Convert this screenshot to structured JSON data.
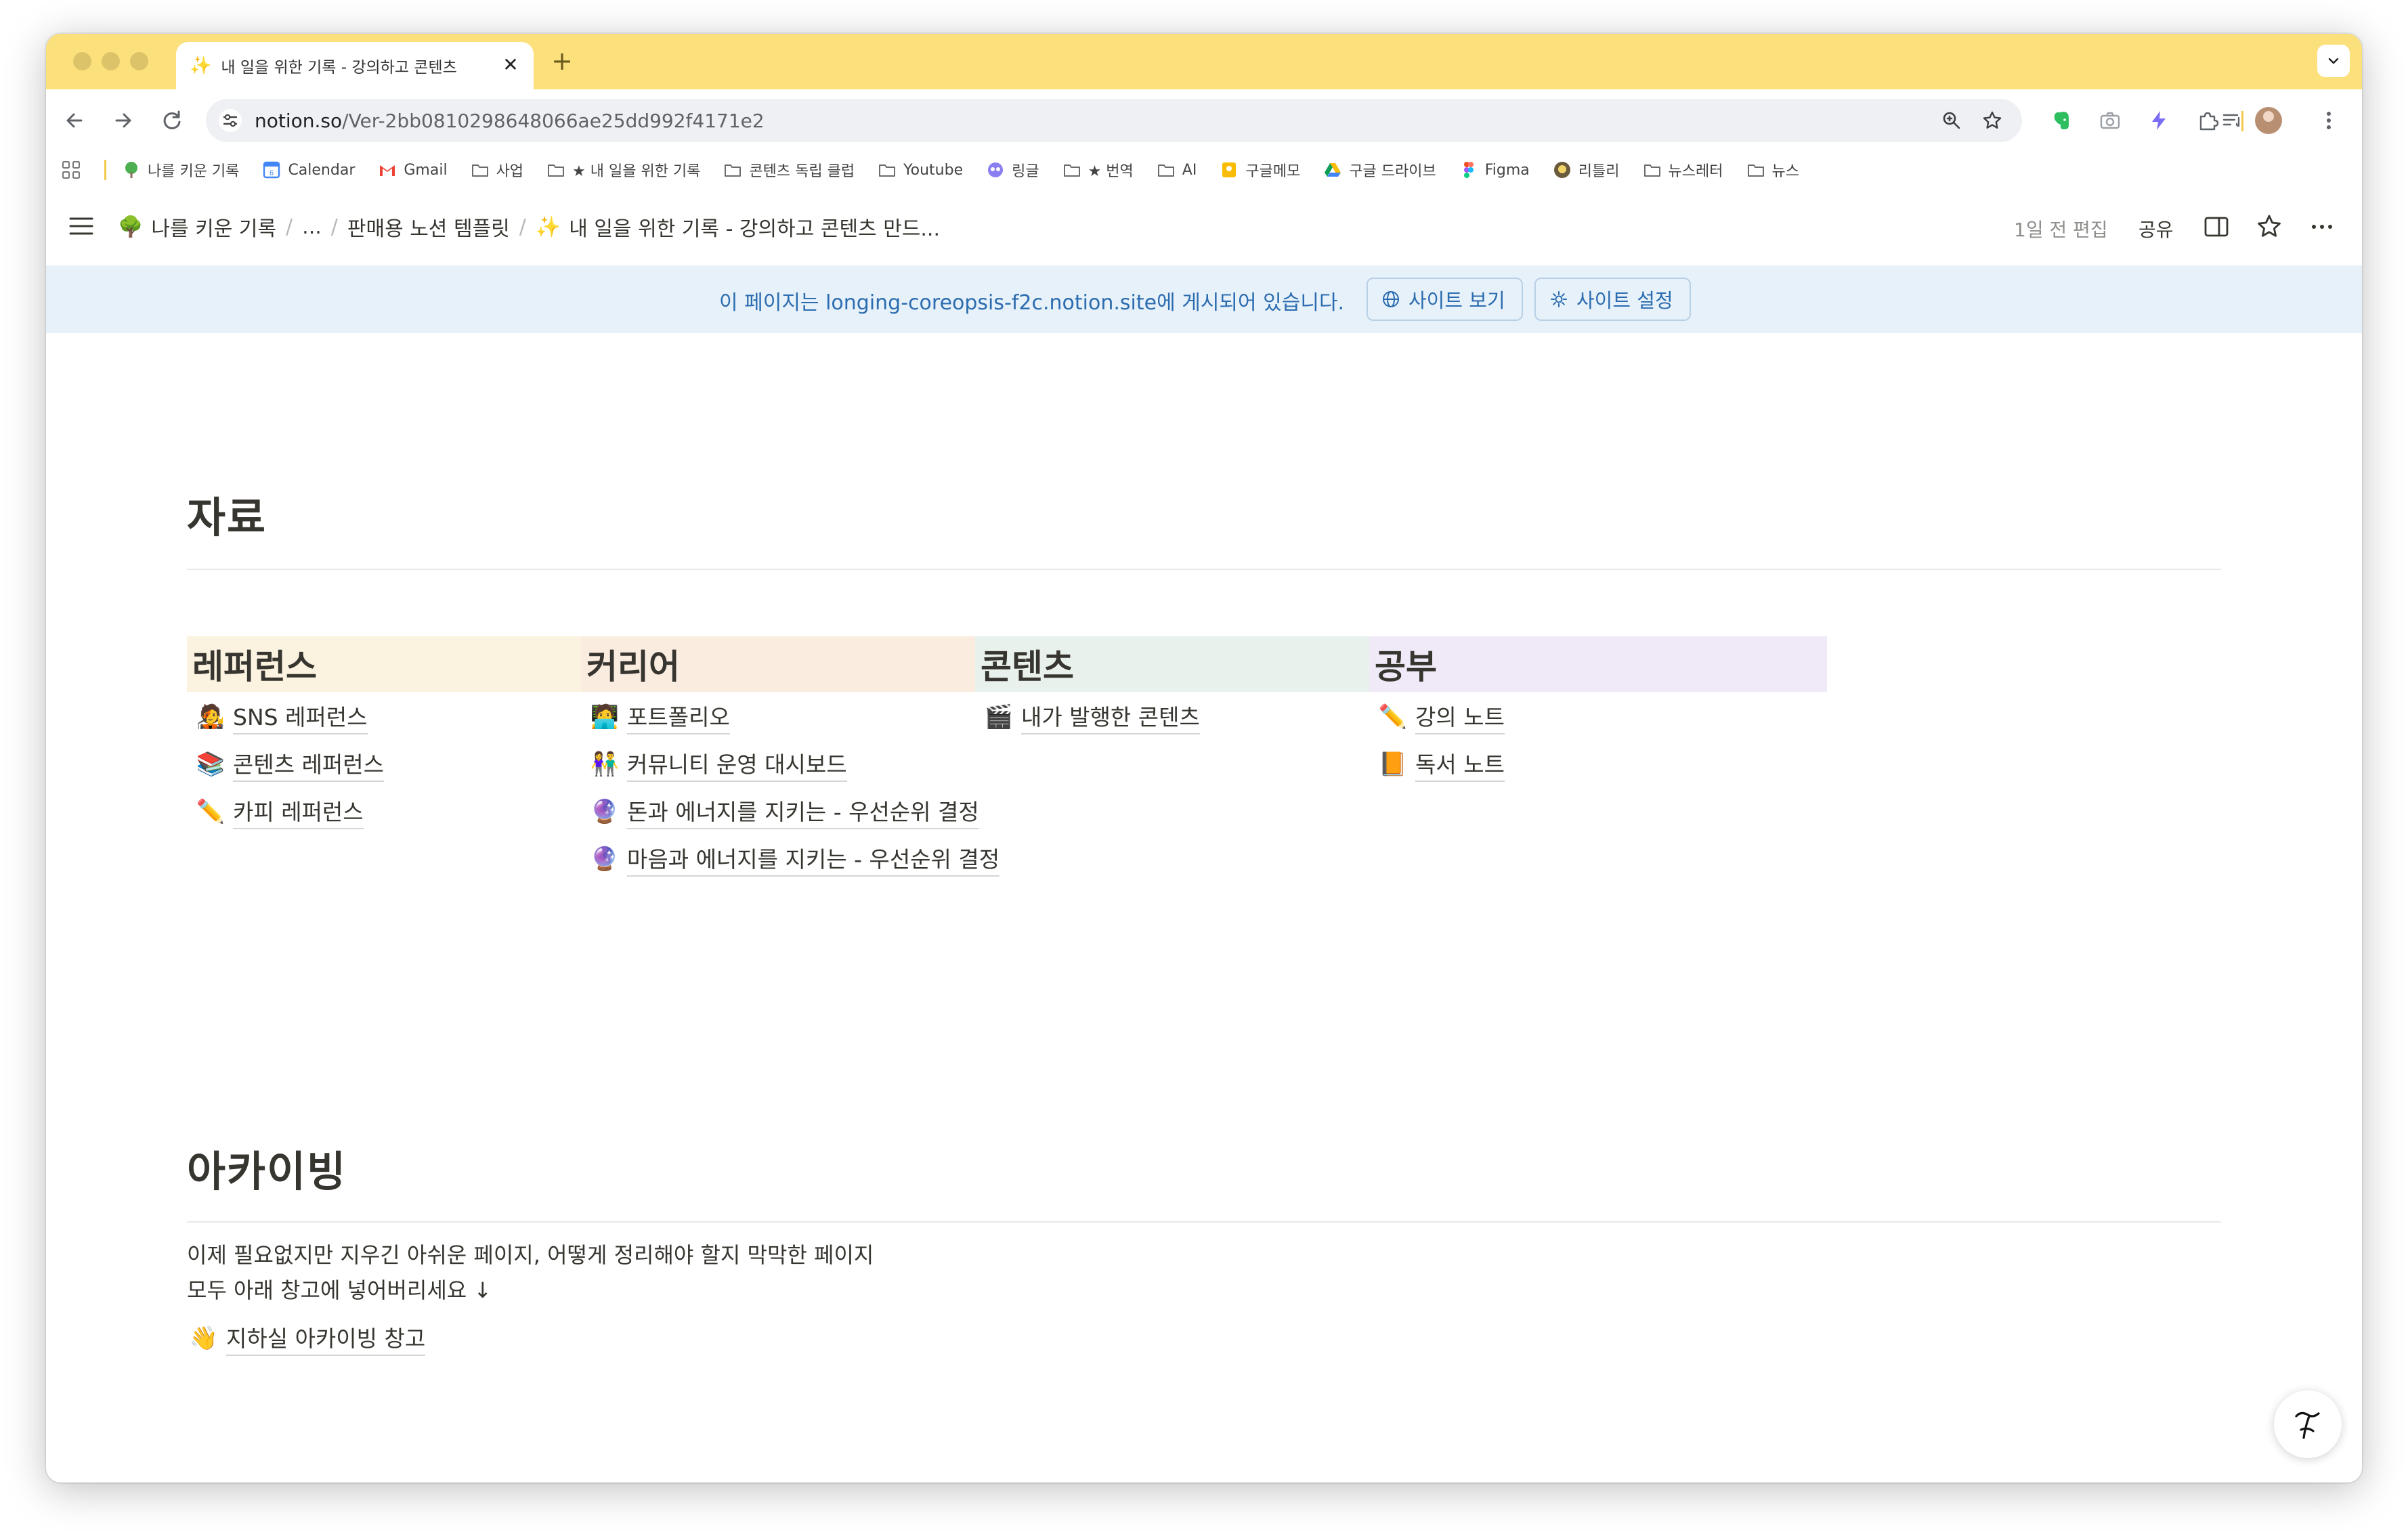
{
  "browser": {
    "tab": {
      "icon": "sparkles-icon",
      "title": "내 일을 위한 기록 - 강의하고 콘텐츠",
      "close": "✕"
    },
    "new_tab": "+",
    "url": {
      "domain": "notion.so",
      "path": "/Ver-2bb0810298648066ae25dd992f4171e2"
    },
    "accent": "#fce07c",
    "bookmarks": [
      {
        "icon": "tree-icon",
        "label": "나를 키운 기록"
      },
      {
        "icon": "calendar-icon",
        "label": "Calendar"
      },
      {
        "icon": "gmail-icon",
        "label": "Gmail"
      },
      {
        "icon": "folder-icon",
        "label": "사업"
      },
      {
        "icon": "folder-icon",
        "label": "★ 내 일을 위한 기록"
      },
      {
        "icon": "folder-icon",
        "label": "콘텐츠 독립 클럽"
      },
      {
        "icon": "folder-icon",
        "label": "Youtube"
      },
      {
        "icon": "link-icon",
        "label": "링글"
      },
      {
        "icon": "folder-icon",
        "label": "★ 번역"
      },
      {
        "icon": "folder-icon",
        "label": "AI"
      },
      {
        "icon": "memo-icon",
        "label": "구글메모"
      },
      {
        "icon": "drive-icon",
        "label": "구글 드라이브"
      },
      {
        "icon": "figma-icon",
        "label": "Figma"
      },
      {
        "icon": "lily-icon",
        "label": "리틀리"
      },
      {
        "icon": "folder-icon",
        "label": "뉴스레터"
      },
      {
        "icon": "folder-icon",
        "label": "뉴스"
      }
    ]
  },
  "notion": {
    "breadcrumbs": [
      {
        "icon": "🌳",
        "label": "나를 키운 기록"
      },
      {
        "icon": "",
        "label": "..."
      },
      {
        "icon": "",
        "label": "판매용 노션 템플릿"
      },
      {
        "icon": "✨",
        "label": "내 일을 위한 기록 - 강의하고 콘텐츠 만드..."
      }
    ],
    "edited": "1일 전 편집",
    "share": "공유",
    "banner": {
      "prefix": "이 페이지는 ",
      "site": "longing-coreopsis-f2c.notion.site",
      "suffix": "에 게시되어 있습니다.",
      "view_site": "사이트 보기",
      "site_settings": "사이트 설정"
    }
  },
  "page": {
    "section1": {
      "title": "자료",
      "columns": [
        {
          "title": "레퍼런스",
          "color": "#fbf3e0",
          "items": [
            {
              "emoji": "🧑‍🎤",
              "label": "SNS 레퍼런스"
            },
            {
              "emoji": "📚",
              "label": "콘텐츠 레퍼런스"
            },
            {
              "emoji": "✏️",
              "label": "카피 레퍼런스"
            }
          ]
        },
        {
          "title": "커리어",
          "color": "#fbece0",
          "items": [
            {
              "emoji": "🧑‍💻",
              "label": "포트폴리오"
            },
            {
              "emoji": "👫",
              "label": "커뮤니티 운영 대시보드"
            },
            {
              "emoji": "🔮",
              "label": "돈과 에너지를 지키는 - 우선순위 결정"
            },
            {
              "emoji": "🔮",
              "label": "마음과 에너지를 지키는 - 우선순위 결정"
            }
          ]
        },
        {
          "title": "콘텐츠",
          "color": "#e9f1ec",
          "items": [
            {
              "emoji": "🎬",
              "label": "내가 발행한 콘텐츠"
            }
          ]
        },
        {
          "title": "공부",
          "color": "#f0eaf8",
          "items": [
            {
              "emoji": "✏️",
              "label": "강의 노트"
            },
            {
              "emoji": "📙",
              "label": "독서 노트"
            }
          ]
        }
      ]
    },
    "section2": {
      "title": "아카이빙",
      "lines": [
        "이제 필요없지만 지우긴 아쉬운 페이지, 어떻게 정리해야 할지 막막한 페이지",
        "모두 아래 창고에 넣어버리세요 ↓"
      ],
      "link": {
        "emoji": "👋",
        "label": "지하실 아카이빙 창고"
      }
    }
  }
}
